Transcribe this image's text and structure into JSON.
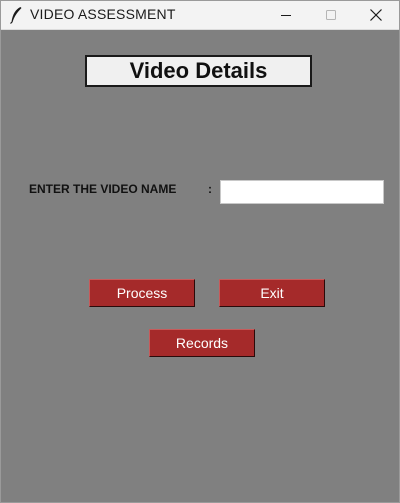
{
  "window": {
    "title": "VIDEO ASSESSMENT",
    "icons": {
      "app": "feather-icon",
      "minimize": "minimize-icon",
      "maximize": "maximize-icon",
      "close": "close-icon"
    }
  },
  "form": {
    "heading": "Video Details",
    "video_name_label": "ENTER THE VIDEO NAME",
    "separator": ":",
    "video_name_value": "",
    "video_name_placeholder": ""
  },
  "buttons": {
    "process_label": "Process",
    "exit_label": "Exit",
    "records_label": "Records"
  },
  "colors": {
    "window_background": "#808080",
    "button_background": "#a52a2a",
    "button_text": "#ffffff",
    "heading_background": "#f0f0f0"
  }
}
